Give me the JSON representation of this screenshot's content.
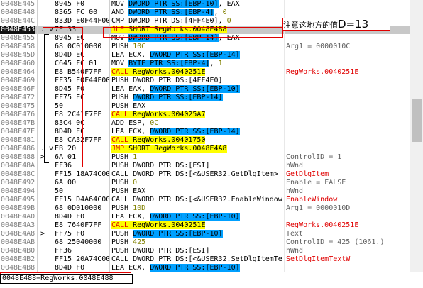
{
  "rows": [
    {
      "addr": "0048E445",
      "mark": "",
      "hex": "8945 F0",
      "dis": [
        {
          "t": "MOV "
        },
        {
          "t": "DWORD PTR SS:[EBP-10]",
          "c": "op-blue"
        },
        {
          "t": ", EAX"
        }
      ],
      "cmt": ""
    },
    {
      "addr": "0048E448",
      "mark": "",
      "hex": "8365 FC 00",
      "dis": [
        {
          "t": "AND "
        },
        {
          "t": "DWORD PTR SS:[EBP-4]",
          "c": "op-blue"
        },
        {
          "t": ", "
        },
        {
          "t": "0",
          "c": "imm"
        }
      ],
      "cmt": ""
    },
    {
      "addr": "0048E44C",
      "mark": "",
      "hex": "833D E0F44F00",
      "dis": [
        {
          "t": "CMP DWORD PTR DS:[4FF4E0], "
        },
        {
          "t": "0",
          "c": "imm"
        }
      ],
      "cmt": ""
    },
    {
      "addr": "0048E453",
      "mark": ". v",
      "hex": "7E 33",
      "dis": [
        {
          "t": "JLE",
          "c": "op-yellow-red"
        },
        {
          "t": " SHORT RegWorks.0048E488",
          "c": "op-yellow"
        }
      ],
      "cmt": "",
      "sel": true
    },
    {
      "addr": "0048E455",
      "mark": "",
      "hex": "8945 EC",
      "dis": [
        {
          "t": "MOV "
        },
        {
          "t": "DWORD PTR SS:[EBP-14]",
          "c": "op-blue"
        },
        {
          "t": ", EAX"
        }
      ],
      "cmt": ""
    },
    {
      "addr": "0048E458",
      "mark": "",
      "hex": "68 0C010000",
      "dis": [
        {
          "t": "PUSH "
        },
        {
          "t": "10C",
          "c": "imm"
        }
      ],
      "cmt": "Arg1 = 0000010C"
    },
    {
      "addr": "0048E45D",
      "mark": "",
      "hex": "8D4D EC",
      "dis": [
        {
          "t": "LEA ECX, "
        },
        {
          "t": "DWORD PTR SS:[EBP-14]",
          "c": "op-blue"
        }
      ],
      "cmt": ""
    },
    {
      "addr": "0048E460",
      "mark": "",
      "hex": "C645 FC 01",
      "dis": [
        {
          "t": "MOV "
        },
        {
          "t": "BYTE PTR SS:[EBP-4]",
          "c": "op-blue"
        },
        {
          "t": ", "
        },
        {
          "t": "1",
          "c": "imm"
        }
      ],
      "cmt": ""
    },
    {
      "addr": "0048E464",
      "mark": "",
      "hex": "E8 B540F7FF",
      "dis": [
        {
          "t": "CALL",
          "c": "op-yellow-red"
        },
        {
          "t": " RegWorks.0040251E",
          "c": "op-yellow"
        }
      ],
      "cmt": "RegWorks.0040251E",
      "cc": "call"
    },
    {
      "addr": "0048E469",
      "mark": "",
      "hex": "FF35 E0F44F00",
      "dis": [
        {
          "t": "PUSH DWORD PTR DS:[4FF4E0]"
        }
      ],
      "cmt": ""
    },
    {
      "addr": "0048E46F",
      "mark": "",
      "hex": "8D45 F0",
      "dis": [
        {
          "t": "LEA EAX, "
        },
        {
          "t": "DWORD PTR SS:[EBP-10]",
          "c": "op-blue"
        }
      ],
      "cmt": ""
    },
    {
      "addr": "0048E472",
      "mark": "",
      "hex": "FF75 EC",
      "dis": [
        {
          "t": "PUSH "
        },
        {
          "t": "DWORD PTR SS:[EBP-14]",
          "c": "op-blue"
        }
      ],
      "cmt": ""
    },
    {
      "addr": "0048E475",
      "mark": "",
      "hex": "50",
      "dis": [
        {
          "t": "PUSH EAX"
        }
      ],
      "cmt": ""
    },
    {
      "addr": "0048E476",
      "mark": "",
      "hex": "E8 2C41F7FF",
      "dis": [
        {
          "t": "CALL",
          "c": "op-yellow-red"
        },
        {
          "t": " RegWorks.004025A7",
          "c": "op-yellow"
        }
      ],
      "cmt": ""
    },
    {
      "addr": "0048E47B",
      "mark": "",
      "hex": "83C4 0C",
      "dis": [
        {
          "t": "ADD ESP, "
        },
        {
          "t": "0C",
          "c": "imm"
        }
      ],
      "cmt": ""
    },
    {
      "addr": "0048E47E",
      "mark": "",
      "hex": "8D4D EC",
      "dis": [
        {
          "t": "LEA ECX, "
        },
        {
          "t": "DWORD PTR SS:[EBP-14]",
          "c": "op-blue"
        }
      ],
      "cmt": ""
    },
    {
      "addr": "0048E481",
      "mark": "",
      "hex": "E8 CA32F7FF",
      "dis": [
        {
          "t": "CALL",
          "c": "op-yellow-red"
        },
        {
          "t": " RegWorks.00401750",
          "c": "op-yellow"
        }
      ],
      "cmt": ""
    },
    {
      "addr": "0048E486",
      "mark": ". v",
      "hex": "EB 20",
      "dis": [
        {
          "t": "JMP",
          "c": "op-yellow-red"
        },
        {
          "t": " SHORT RegWorks.0048E4A8",
          "c": "op-yellow"
        }
      ],
      "cmt": ""
    },
    {
      "addr": "0048E488",
      "mark": ">",
      "hex": "6A 01",
      "dis": [
        {
          "t": "PUSH "
        },
        {
          "t": "1",
          "c": "imm"
        }
      ],
      "cmt": "ControlID = 1"
    },
    {
      "addr": "0048E48A",
      "mark": "",
      "hex": "FF36",
      "dis": [
        {
          "t": "PUSH DWORD PTR DS:[ESI]"
        }
      ],
      "cmt": "hWnd"
    },
    {
      "addr": "0048E48C",
      "mark": "",
      "hex": "FF15 18A74C00",
      "dis": [
        {
          "t": "CALL DWORD PTR DS:[<&USER32.GetDlgItem>"
        }
      ],
      "cmt": "GetDlgItem",
      "cc": "call"
    },
    {
      "addr": "0048E492",
      "mark": "",
      "hex": "6A 00",
      "dis": [
        {
          "t": "PUSH "
        },
        {
          "t": "0",
          "c": "imm"
        }
      ],
      "cmt": "Enable = FALSE"
    },
    {
      "addr": "0048E494",
      "mark": "",
      "hex": "50",
      "dis": [
        {
          "t": "PUSH EAX"
        }
      ],
      "cmt": "hWnd"
    },
    {
      "addr": "0048E495",
      "mark": "",
      "hex": "FF15 D4A64C00",
      "dis": [
        {
          "t": "CALL DWORD PTR DS:[<&USER32.EnableWindow"
        }
      ],
      "cmt": "EnableWindow",
      "cc": "call"
    },
    {
      "addr": "0048E49B",
      "mark": "",
      "hex": "68 0D010000",
      "dis": [
        {
          "t": "PUSH "
        },
        {
          "t": "10D",
          "c": "imm"
        }
      ],
      "cmt": "Arg1 = 0000010D"
    },
    {
      "addr": "0048E4A0",
      "mark": "",
      "hex": "8D4D F0",
      "dis": [
        {
          "t": "LEA ECX, "
        },
        {
          "t": "DWORD PTR SS:[EBP-10]",
          "c": "op-blue"
        }
      ],
      "cmt": ""
    },
    {
      "addr": "0048E4A3",
      "mark": "",
      "hex": "E8 7640F7FF",
      "dis": [
        {
          "t": "CALL",
          "c": "op-yellow-red"
        },
        {
          "t": " RegWorks.0040251E",
          "c": "op-yellow"
        }
      ],
      "cmt": "RegWorks.0040251E",
      "cc": "call"
    },
    {
      "addr": "0048E4A8",
      "mark": ">",
      "hex": "FF75 F0",
      "dis": [
        {
          "t": "PUSH "
        },
        {
          "t": "DWORD PTR SS:[EBP-10]",
          "c": "op-blue"
        }
      ],
      "cmt": "Text"
    },
    {
      "addr": "0048E4AB",
      "mark": "",
      "hex": "68 25040000",
      "dis": [
        {
          "t": "PUSH "
        },
        {
          "t": "425",
          "c": "imm"
        }
      ],
      "cmt": "ControlID = 425 (1061.)"
    },
    {
      "addr": "0048E4B0",
      "mark": "",
      "hex": "FF36",
      "dis": [
        {
          "t": "PUSH DWORD PTR DS:[ESI]"
        }
      ],
      "cmt": "hWnd"
    },
    {
      "addr": "0048E4B2",
      "mark": "",
      "hex": "FF15 20A74C00",
      "dis": [
        {
          "t": "CALL DWORD PTR DS:[<&USER32.SetDlgItemTe"
        }
      ],
      "cmt": "SetDlgItemTextW",
      "cc": "call"
    },
    {
      "addr": "0048E4B8",
      "mark": "",
      "hex": "8D4D F0",
      "dis": [
        {
          "t": "LEA ECX, "
        },
        {
          "t": "DWORD PTR SS:[EBP-10]",
          "c": "op-blue"
        }
      ],
      "cmt": ""
    }
  ],
  "annotation": {
    "text": "注意这地方的值",
    "value": "D=13"
  },
  "status": "0048E488=RegWorks.0048E488",
  "colors": {
    "selection": "#c8c8c8",
    "operand_highlight": "#00a0ff",
    "jump_highlight": "#ffff00",
    "annotation_border": "#e00000"
  }
}
